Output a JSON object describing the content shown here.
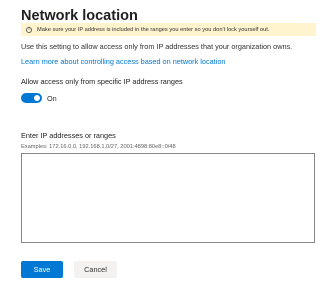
{
  "panel": {
    "title": "Network location",
    "warning": "Make sure your IP address is included in the ranges you enter so you don't lock yourself out.",
    "warning_icon": "info-icon",
    "description": "Use this setting to allow access only from IP addresses that your organization owns.",
    "learn_more_link": "Learn more about controlling access based on network location",
    "link_color": "#0078d4"
  },
  "toggle": {
    "label": "Allow access only from specific IP address ranges",
    "state_text": "On",
    "checked": true,
    "color": "#0078d4"
  },
  "ip_ranges": {
    "label": "Enter IP addresses or ranges",
    "examples": "Examples: 172.16.0.0, 192.168.1.0/27, 2001:4898:80e8::0/48",
    "value": ""
  },
  "actions": {
    "save_label": "Save",
    "cancel_label": "Cancel",
    "accent": "#0078d4"
  }
}
